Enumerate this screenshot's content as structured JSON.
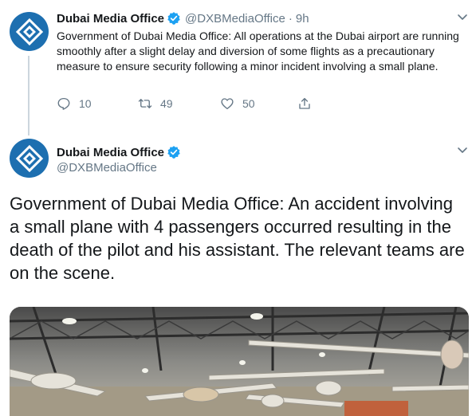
{
  "tweet1": {
    "author_name": "Dubai Media Office",
    "handle": "@DXBMediaOffice",
    "separator": "·",
    "time": "9h",
    "text": "Government of Dubai Media Office: All operations at the Dubai airport are running smoothly after a slight delay and diversion of some flights as a precautionary measure to ensure security following a minor incident involving a small plane.",
    "replies": "10",
    "retweets": "49",
    "likes": "50"
  },
  "tweet2": {
    "author_name": "Dubai Media Office",
    "handle": "@DXBMediaOffice",
    "text": "Government of Dubai Media Office: An accident involving a small plane with 4 passengers occurred resulting in the death of the pilot and his assistant. The relevant teams are on the scene."
  },
  "colors": {
    "brand_blue": "#1d6fb0",
    "verified_blue": "#1da1f2",
    "secondary_text": "#657786",
    "thread_line": "#ccd6dd"
  },
  "icons": {
    "reply": "reply-icon",
    "retweet": "retweet-icon",
    "like": "heart-icon",
    "share": "share-icon",
    "verified": "verified-badge-icon",
    "menu": "chevron-down-icon"
  }
}
